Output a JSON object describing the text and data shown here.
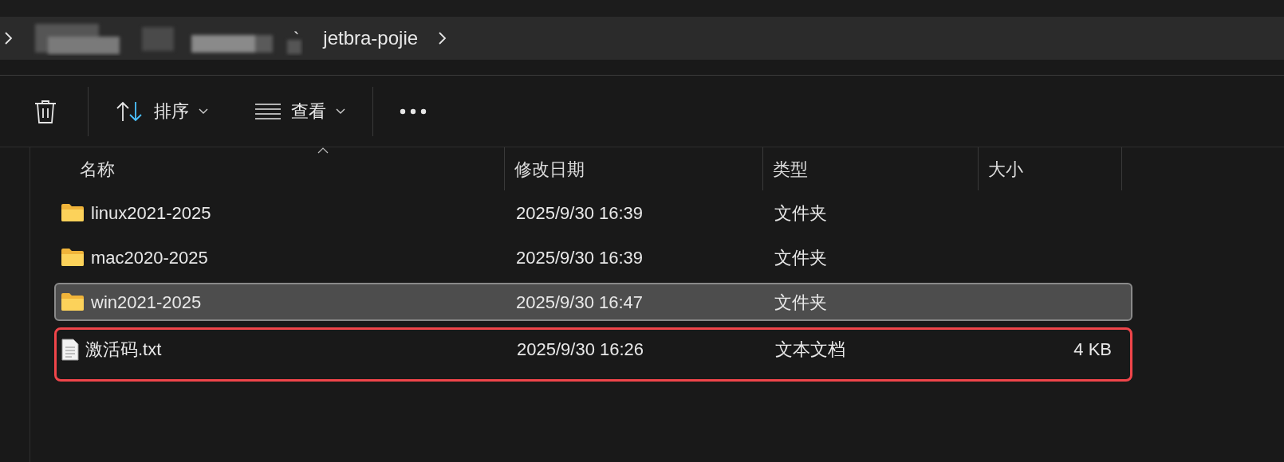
{
  "address_bar": {
    "separator": "`",
    "current_folder": "jetbra-pojie"
  },
  "toolbar": {
    "sort": {
      "label": "排序"
    },
    "view": {
      "label": "查看"
    }
  },
  "table": {
    "columns": [
      "名称",
      "修改日期",
      "类型",
      "大小"
    ],
    "rows": [
      {
        "kind": "folder",
        "name": "linux2021-2025",
        "modified": "2025/9/30 16:39",
        "type": "文件夹",
        "selected": false,
        "highlighted": false
      },
      {
        "kind": "folder",
        "name": "mac2020-2025",
        "modified": "2025/9/30 16:39",
        "type": "文件夹",
        "selected": false,
        "highlighted": false
      },
      {
        "kind": "folder",
        "name": "win2021-2025",
        "modified": "2025/9/30 16:47",
        "type": "文件夹",
        "selected": true,
        "highlighted": false
      },
      {
        "kind": "file",
        "name": "激活码.txt",
        "modified": "2025/9/30 16:26",
        "type": "文本文档",
        "size": "4 KB",
        "selected": false,
        "highlighted": true
      }
    ]
  }
}
